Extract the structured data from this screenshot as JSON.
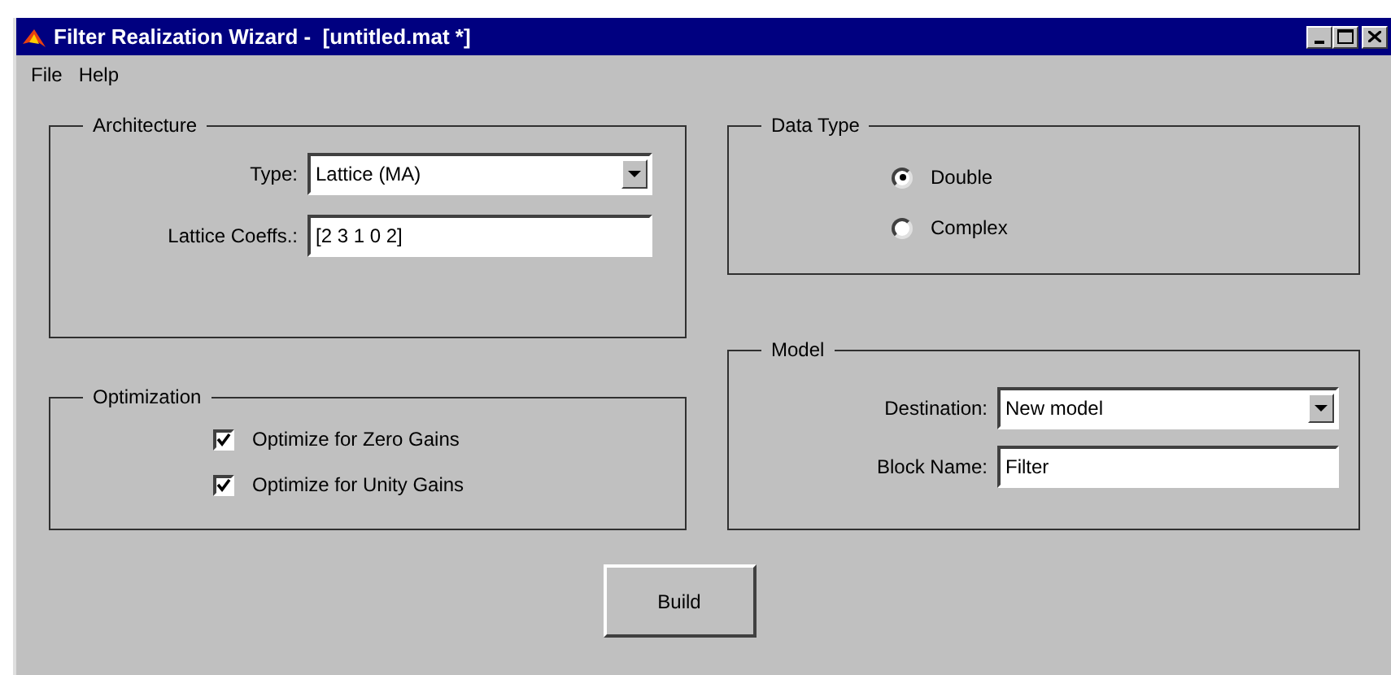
{
  "window": {
    "title": "Filter Realization Wizard -  [untitled.mat *]"
  },
  "menu": [
    {
      "label": "File"
    },
    {
      "label": "Help"
    }
  ],
  "architecture": {
    "title": "Architecture",
    "fields": [
      {
        "kind": "dropdown",
        "label": "Type:",
        "value": "Lattice (MA)"
      },
      {
        "kind": "text",
        "label": "Lattice Coeffs.:",
        "value": "[2 3 1 0 2]"
      }
    ]
  },
  "optimization": {
    "title": "Optimization",
    "options": [
      {
        "label": "Optimize for Zero Gains",
        "checked": true
      },
      {
        "label": "Optimize for Unity Gains",
        "checked": true
      }
    ]
  },
  "data_type": {
    "title": "Data Type",
    "options": [
      {
        "label": "Double",
        "selected": true
      },
      {
        "label": "Complex",
        "selected": false
      }
    ]
  },
  "model": {
    "title": "Model",
    "fields": [
      {
        "kind": "dropdown",
        "label": "Destination:",
        "value": "New model"
      },
      {
        "kind": "text",
        "label": "Block Name:",
        "value": "Filter"
      }
    ]
  },
  "buttons": [
    {
      "label": "Build"
    }
  ]
}
